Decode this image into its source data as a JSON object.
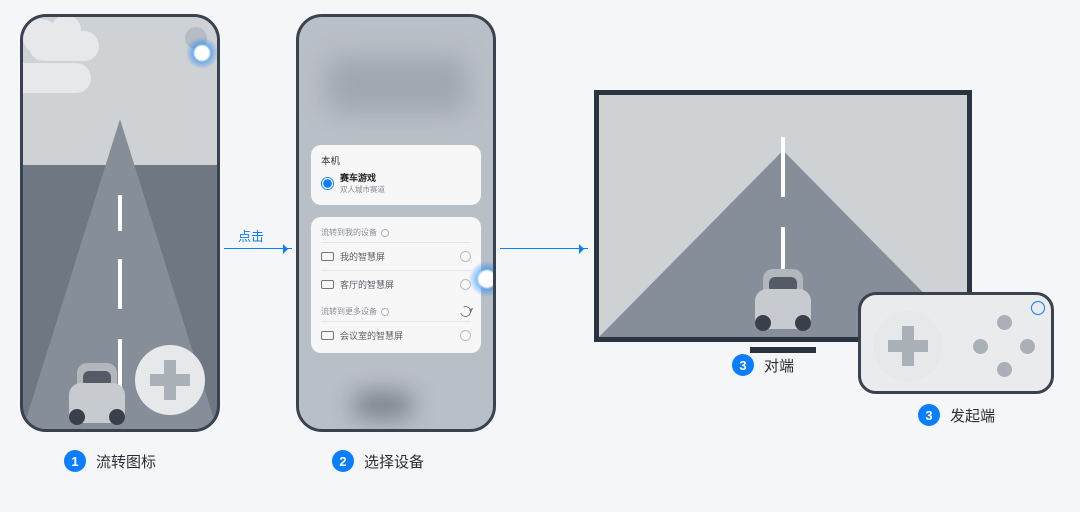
{
  "arrow_label": "点击",
  "phone2": {
    "local_title": "本机",
    "app_name": "赛车游戏",
    "app_sub": "双人城市赛道",
    "section_my": "流转到我的设备",
    "section_more": "流转到更多设备",
    "devices_my": [
      "我的智慧屏",
      "客厅的智慧屏"
    ],
    "devices_more": [
      "会议室的智慧屏"
    ]
  },
  "steps": {
    "s1_num": "1",
    "s1_txt": "流转图标",
    "s2_num": "2",
    "s2_txt": "选择设备",
    "s3_num": "3",
    "s3_txt": "对端",
    "s4_num": "3",
    "s4_txt": "发起端"
  }
}
